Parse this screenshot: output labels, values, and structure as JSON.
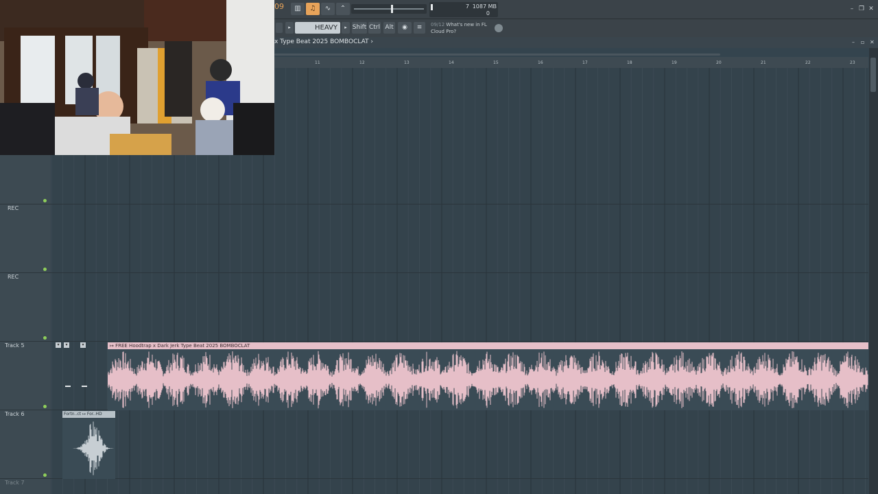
{
  "toolbar": {
    "pattern_number": "09",
    "cpu_value": "7",
    "memory": "1087 MB",
    "voices": "0",
    "hint_text": "HEAVY",
    "shift_label": "Shift",
    "ctrl_label": "Ctrl",
    "alt_label": "Alt",
    "news_date": "09/12",
    "news_text": "What's new in FL Cloud Pro?"
  },
  "playlist": {
    "title": "x Type Beat 2025 BOMBOCLAT",
    "ruler_ticks": [
      "11",
      "12",
      "13",
      "14",
      "15",
      "16",
      "17",
      "18",
      "19",
      "20",
      "21",
      "22",
      "23"
    ]
  },
  "tracks": [
    {
      "label": "REC"
    },
    {
      "label": "REC"
    },
    {
      "label": "Track 5"
    },
    {
      "label": "Track 6"
    },
    {
      "label": "Track 7"
    }
  ],
  "clips": {
    "main_clip_name": "FREE Hoodtrap x Dark Jerk Type Beat 2025 BOMBOCLAT",
    "small_clip_name": "Fortn..ct ↦ For..HD"
  },
  "colors": {
    "accent_orange": "#e7a35a",
    "clip_pink": "#e6bfc8",
    "grid_bg": "#34434c",
    "led_green": "#8fcf5a"
  }
}
